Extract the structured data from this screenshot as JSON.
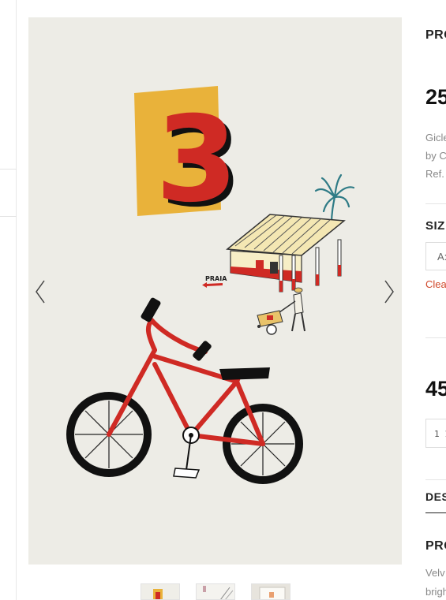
{
  "product": {
    "title": "PRO",
    "price": "25",
    "description_lines": [
      "Gicle",
      "by C",
      "Ref."
    ]
  },
  "variations": {
    "size_label": "SIZ",
    "size_selected": "A:",
    "clear_label": "Clea"
  },
  "variation_price": "45",
  "quantity": "1 1",
  "tabs": {
    "description_label": "DES"
  },
  "section": {
    "title": "PRO",
    "body_lines": [
      "Velv",
      "brigh"
    ]
  },
  "artwork": {
    "number": "3",
    "sign_text": "PRAIA"
  },
  "colors": {
    "accent_link": "#d0492b",
    "paper": "#edece6",
    "yellow": "#e9b23a",
    "red": "#cf2a24"
  },
  "icons": {
    "prev": "chevron-left-icon",
    "next": "chevron-right-icon"
  }
}
